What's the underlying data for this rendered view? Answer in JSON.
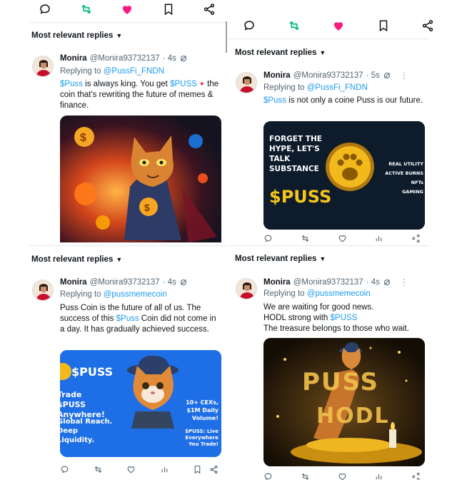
{
  "colors": {
    "link": "#1d9bf0",
    "like": "#f91880",
    "repost": "#00ba7c",
    "muted": "#536471"
  },
  "icons": [
    "reply-icon",
    "repost-icon",
    "like-icon",
    "bookmark-icon",
    "share-icon",
    "grok-icon",
    "more-icon",
    "chevron-down-icon",
    "views-icon"
  ],
  "filter_label": "Most relevant replies",
  "tweets": [
    {
      "name": "Monira",
      "handle": "@Monira93732137",
      "time": "· 4s",
      "replying_prefix": "Replying to ",
      "replying_to": "@PussFi_FNDN",
      "text_link": "$Puss",
      "text_mid": " is always king. You get ",
      "text_link2": "$PUSS",
      "text_end": " the coin that's rewriting the future of memes & finance."
    },
    {
      "name": "Monira",
      "handle": "@Monira93732137",
      "time": "· 5s",
      "replying_prefix": "Replying to ",
      "replying_to": "@PussFi_FNDN",
      "text_link": "$Puss",
      "text_end": " is not only a coine Puss is our future.",
      "media": {
        "headline": "FORGET THE HYPE, LET'S TALK SUBSTANCE",
        "ticker": "$PUSS",
        "features": [
          "REAL UTILITY",
          "ACTIVE BURNS",
          "NFTs",
          "GAMING"
        ]
      }
    },
    {
      "name": "Monira",
      "handle": "@Monira93732137",
      "time": "· 4s",
      "replying_prefix": "Replying to ",
      "replying_to": "@pussmemecoin",
      "text_start": "Puss Coin is the future of all of us. The success of this ",
      "text_link": "$Puss",
      "text_end": " Coin did not come in a day. It has gradually achieved success.",
      "media": {
        "ticker": "$PUSS",
        "line1": "Trade $PUSS Anywhere!",
        "line2": "Global Reach. Deep Liquidity.",
        "badge": "10+ CEXs, $1M Daily Volume!",
        "live": "$PUSS: Live Everywhere You Trade!"
      }
    },
    {
      "name": "Monira",
      "handle": "@Monira93732137",
      "time": "· 4s",
      "replying_prefix": "Replying to ",
      "replying_to": "@pussmemecoin",
      "line1": "We are waiting for good news.",
      "line2_start": "HODL strong with ",
      "line2_link": "$PUSS",
      "line3": "The treasure belongs to those who wait.",
      "media": {
        "word1": "PUSS",
        "word2": "HODL"
      }
    }
  ]
}
